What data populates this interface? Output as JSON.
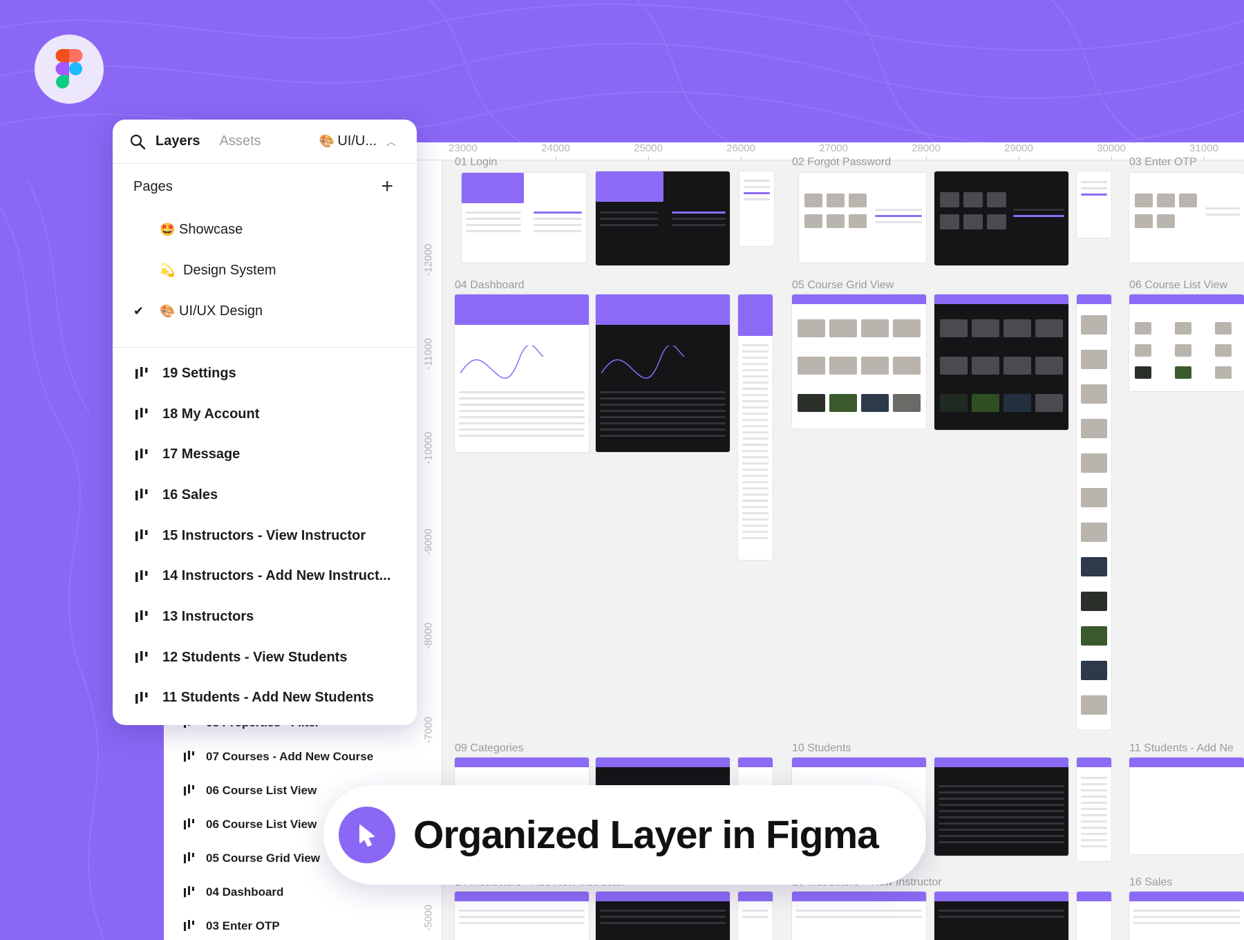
{
  "panel": {
    "tabs": {
      "layers": "Layers",
      "assets": "Assets"
    },
    "page_select": {
      "emoji": "🎨",
      "label": "UI/U..."
    },
    "pages_title": "Pages",
    "pages": [
      {
        "emoji": "🤩",
        "label": "Showcase",
        "checked": false
      },
      {
        "emoji": "💫",
        "label": "Design System",
        "checked": false
      },
      {
        "emoji": "🎨",
        "label": "UI/UX Design",
        "checked": true
      }
    ],
    "frames": [
      "19 Settings",
      "18 My Account",
      "17 Message",
      "16 Sales",
      "15 Instructors - View Instructor",
      "14 Instructors - Add New Instruct...",
      "13 Instructors",
      "12 Students - View Students",
      "11 Students - Add New Students"
    ]
  },
  "lower_frames": [
    "08 Properties - Filter",
    "07 Courses - Add New Course",
    "06 Course List View",
    "06 Course List View",
    "05 Course Grid View",
    "04 Dashboard",
    "03 Enter OTP"
  ],
  "canvas": {
    "ruler_x": [
      "23000",
      "24000",
      "25000",
      "26000",
      "27000",
      "28000",
      "29000",
      "30000",
      "31000"
    ],
    "ruler_y": [
      "-12000",
      "-11000",
      "-10000",
      "-9000",
      "-8000",
      "-7000",
      "-5000"
    ],
    "frame_labels": [
      "01 Login",
      "02 Forgot Password",
      "03 Enter OTP",
      "04 Dashboard",
      "05 Course Grid View",
      "06 Course List View",
      "09 Categories",
      "10 Students",
      "11 Students - Add Ne",
      "14 Instructors - Add New Instructor",
      "15 Instructors - View Instructor",
      "16 Sales"
    ]
  },
  "banner": {
    "text": "Organized Layer in Figma"
  },
  "colors": {
    "accent": "#8a68f5",
    "panel_bg": "#ffffff",
    "canvas_bg": "#f2f2f2"
  }
}
